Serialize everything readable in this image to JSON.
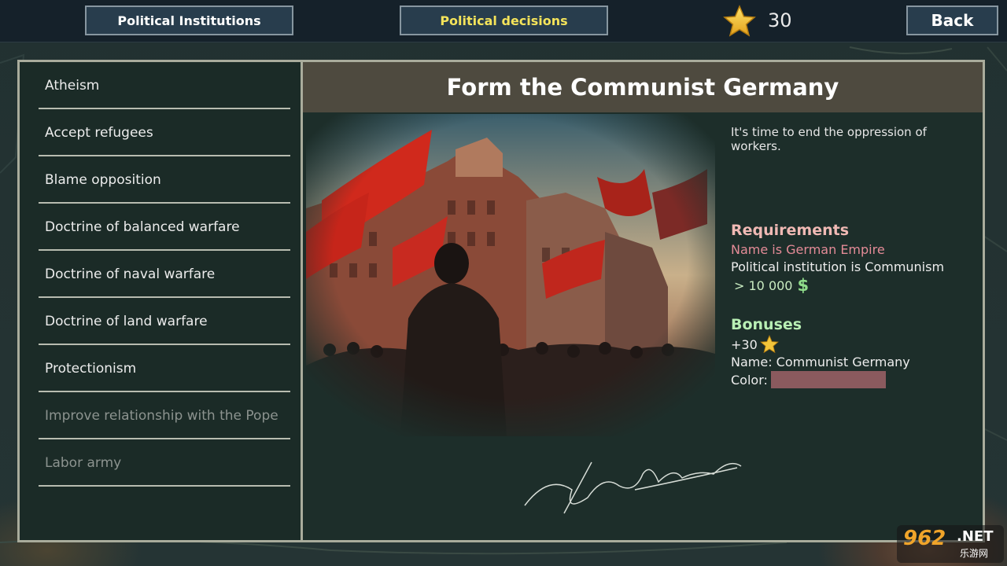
{
  "topbar": {
    "institutions_label": "Political Institutions",
    "decisions_label": "Political decisions",
    "points": "30",
    "back_label": "Back"
  },
  "sidebar": {
    "items": [
      {
        "label": "Atheism",
        "enabled": true
      },
      {
        "label": "Accept refugees",
        "enabled": true
      },
      {
        "label": "Blame opposition",
        "enabled": true
      },
      {
        "label": "Doctrine of balanced warfare",
        "enabled": true
      },
      {
        "label": "Doctrine of naval warfare",
        "enabled": true
      },
      {
        "label": "Doctrine of land warfare",
        "enabled": true
      },
      {
        "label": "Protectionism",
        "enabled": true
      },
      {
        "label": "Improve relationship with the Pope",
        "enabled": false
      },
      {
        "label": "Labor army",
        "enabled": false
      }
    ]
  },
  "decision": {
    "title": "Form the Communist Germany",
    "description": "It's time to end the oppression of workers.",
    "requirements_title": "Requirements",
    "requirements": {
      "unmet": "Name is German Empire",
      "met": "Political institution is Communism",
      "money": "> 10 000",
      "money_icon": "dollar-icon"
    },
    "bonuses_title": "Bonuses",
    "bonuses": {
      "points": "+30",
      "points_icon": "star-icon",
      "name": "Name: Communist Germany",
      "color_label": "Color:",
      "color_value": "#8a5a5e"
    }
  },
  "colors": {
    "accent_yellow": "#f4e35a",
    "requirement_unmet": "#e48b97",
    "requirements_title": "#f0b9b4",
    "bonuses_title": "#b8efb4",
    "panel_border": "#a9ac9c",
    "title_bar": "#4e4a3f"
  },
  "watermark": {
    "number": "962",
    "suffix": ".NET",
    "chinese": "乐游网"
  }
}
